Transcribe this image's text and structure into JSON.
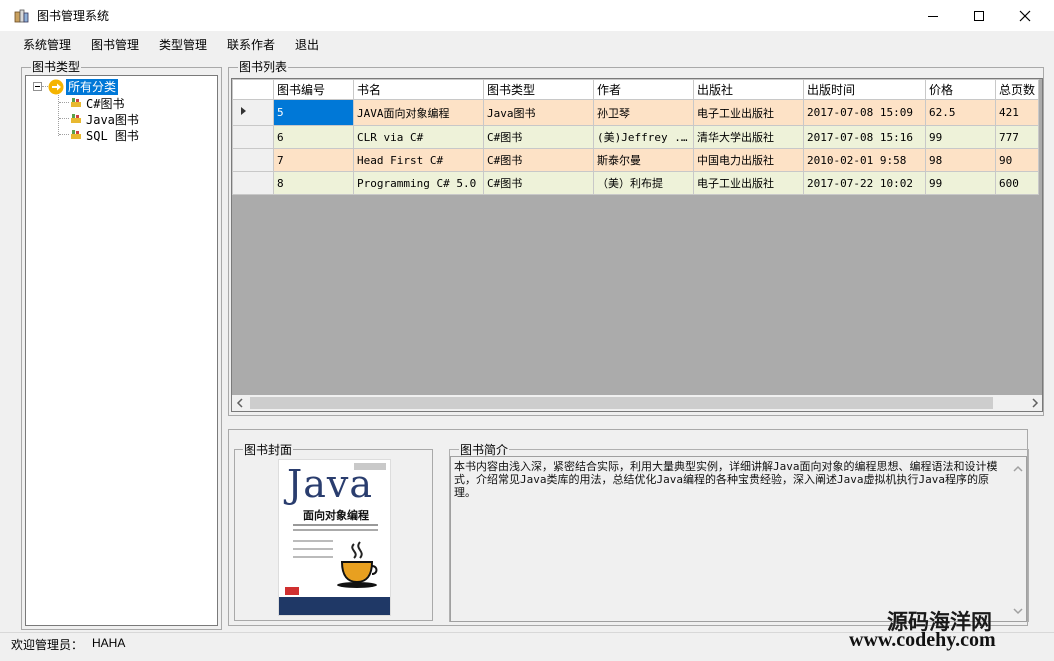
{
  "window": {
    "title": "图书管理系统"
  },
  "menu": [
    "系统管理",
    "图书管理",
    "类型管理",
    "联系作者",
    "退出"
  ],
  "tree": {
    "group_title": "图书类型",
    "root": "所有分类",
    "children": [
      "C#图书",
      "Java图书",
      "SQL 图书"
    ]
  },
  "grid": {
    "group_title": "图书列表",
    "columns": [
      "图书编号",
      "书名",
      "图书类型",
      "作者",
      "出版社",
      "出版时间",
      "价格",
      "总页数"
    ],
    "rows": [
      [
        "5",
        "JAVA面向对象编程",
        "Java图书",
        "孙卫琴",
        "电子工业出版社",
        "2017-07-08 15:09",
        "62.5",
        "421"
      ],
      [
        "6",
        "CLR via C#",
        "C#图书",
        "(美)Jeffrey ...",
        "清华大学出版社",
        "2017-07-08 15:16",
        "99",
        "777"
      ],
      [
        "7",
        "Head First C#",
        "C#图书",
        "斯泰尔曼",
        "中国电力出版社",
        "2010-02-01 9:58",
        "98",
        "90"
      ],
      [
        "8",
        "Programming C# 5.0",
        "C#图书",
        "（美）利布提",
        "电子工业出版社",
        "2017-07-22 10:02",
        "99",
        "600"
      ]
    ]
  },
  "cover": {
    "group_title": "图书封面",
    "title_word": "Java",
    "subtitle": "面向对象编程"
  },
  "intro": {
    "group_title": "图书简介",
    "text": "本书内容由浅入深，紧密结合实际，利用大量典型实例，详细讲解Java面向对象的编程思想、编程语法和设计模式，介绍常见Java类库的用法，总结优化Java编程的各种宝贵经验，深入阐述Java虚拟机执行Java程序的原理。"
  },
  "status": {
    "label": "欢迎管理员：",
    "user": "HAHA"
  },
  "watermark": {
    "line1": "源码海洋网",
    "line2": "www.codehy.com"
  },
  "colors": {
    "row_odd": "#fde2c6",
    "row_even": "#eef2d9",
    "selection": "#0078d7"
  }
}
